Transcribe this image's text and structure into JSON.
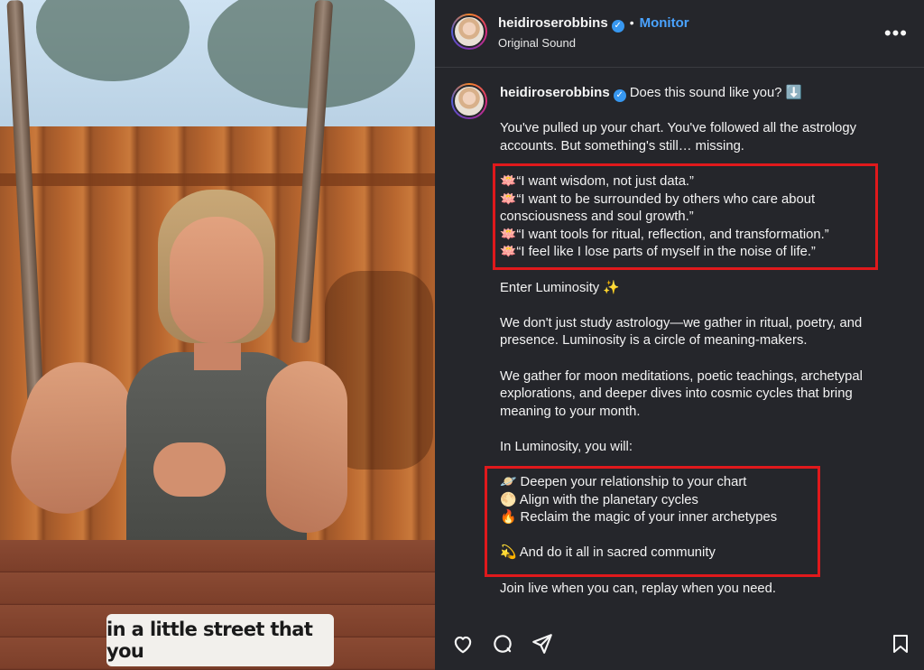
{
  "video": {
    "caption": "in a little street that you"
  },
  "header": {
    "username": "heidiroserobbins",
    "separator": "•",
    "follow_label": "Monitor",
    "audio": "Original Sound",
    "more_label": "•••"
  },
  "post": {
    "username": "heidiroserobbins",
    "first_line": "Does this sound like you? ⬇️",
    "paragraph1": [
      "You've pulled up your chart. You've followed all the astrology",
      "accounts. But something's still… missing."
    ],
    "quotes": [
      "🪷“I want wisdom, not just data.”",
      "🪷“I want to be surrounded by others who care about",
      "consciousness and soul growth.”",
      "🪷“I want tools for ritual, reflection, and transformation.”",
      "🪷“I feel like I lose parts of myself in the noise of life.”"
    ],
    "enter": "Enter Luminosity ✨",
    "paragraph2": [
      "We don't just study astrology—we gather in ritual, poetry, and",
      "presence. Luminosity is a circle of meaning-makers."
    ],
    "paragraph3": [
      "We gather for moon meditations, poetic teachings, archetypal",
      "explorations, and deeper dives into cosmic cycles that bring",
      "meaning to your month."
    ],
    "you_will": "In Luminosity, you will:",
    "benefits": [
      "🪐 Deepen your relationship to your chart",
      "🌕 Align with the planetary cycles",
      "🔥 Reclaim the magic of your inner archetypes"
    ],
    "community": "💫 And do it all in sacred community",
    "join": "Join live when you can, replay when you need."
  },
  "actions": {
    "like_icon": "heart-icon",
    "comment_icon": "comment-icon",
    "share_icon": "share-icon",
    "save_icon": "bookmark-icon"
  },
  "colors": {
    "panel_bg": "#25262b",
    "accent": "#4aa3ff",
    "highlight_box": "#e0191c"
  }
}
